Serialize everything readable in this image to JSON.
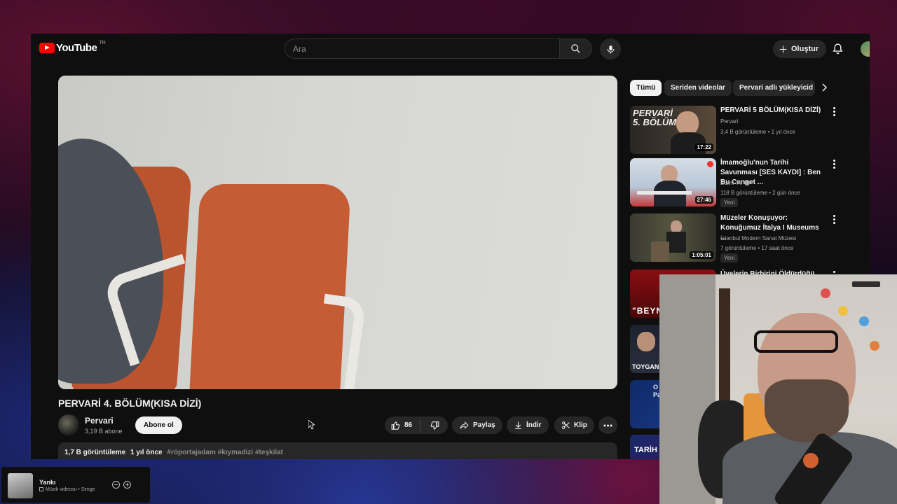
{
  "header": {
    "logo_text": "YouTube",
    "country_code": "TR",
    "search_placeholder": "Ara",
    "create_label": "Oluştur"
  },
  "video": {
    "title": "PERVARİ 4. BÖLÜM(KISA DİZİ)",
    "channel_name": "Pervari",
    "subscribers": "3,19 B abone",
    "subscribe_label": "Abone ol",
    "like_count": "86",
    "share_label": "Paylaş",
    "download_label": "İndir",
    "clip_label": "Klip",
    "views": "1,7 B görüntüleme",
    "age": "1 yıl önce",
    "hashtags": "#röportajadam #kıymadizi #teşkilat"
  },
  "sidebar": {
    "chips": [
      {
        "label": "Tümü",
        "active": true
      },
      {
        "label": "Seriden videolar",
        "active": false
      },
      {
        "label": "Pervari adlı yükleyicid",
        "active": false
      }
    ],
    "recommendations": [
      {
        "title": "PERVARİ 5  BÖLÜM(KISA DİZİ)",
        "thumb_text": "PERVARİ\n5. BÖLÜM",
        "channel": "Pervari",
        "meta": "3,4 B görüntüleme • 1 yıl önce",
        "duration": "17:22",
        "badge": ""
      },
      {
        "title": "İmamoğlu'nun Tarihi Savunması [SES KAYDI] : Ben Bu Cennet ...",
        "channel": "Bizim TV",
        "meta": "118 B görüntüleme • 2 gün önce",
        "duration": "27:46",
        "badge": "Yeni"
      },
      {
        "title": "Müzeler Konuşuyor: Konuğumuz İtalya I Museums ...",
        "channel": "İstanbul Modern Sanat Müzesi",
        "meta": "7 görüntüleme • 17 saat önce",
        "duration": "1:05:01",
        "badge": "Yeni"
      },
      {
        "title": "Üyelerin Birbirini Öldürdüğü...",
        "thumb_text": "\"BEYN",
        "channel": "",
        "meta": "",
        "duration": "",
        "badge": ""
      },
      {
        "title": "",
        "thumb_text": "TOYGAN AV",
        "channel": "",
        "meta": "",
        "duration": "",
        "badge": ""
      },
      {
        "title": "",
        "thumb_text": "O\nPa",
        "channel": "",
        "meta": "",
        "duration": "",
        "badge": ""
      },
      {
        "title": "",
        "thumb_text": "TARİH",
        "channel": "",
        "meta": "",
        "duration": "",
        "badge": ""
      }
    ]
  },
  "mini_player": {
    "title": "Yankı",
    "subtitle": "Müzik videosu • Simge"
  },
  "colors": {
    "yt_red": "#ff0000",
    "bg": "#0f0f0f",
    "chip_bg": "#272727"
  }
}
